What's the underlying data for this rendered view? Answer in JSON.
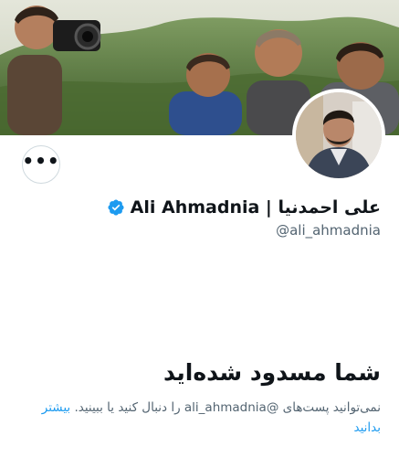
{
  "profile": {
    "display_name": "Ali Ahmadnia | علی احمدنیا",
    "handle": "@ali_ahmadnia",
    "verified": true,
    "more_icon": "more-horizontal-icon",
    "more_label": "•••"
  },
  "blocked": {
    "title": "شما مسدود شده‌اید",
    "message": "نمی‌توانید پست‌های @ali_ahmadnia را دنبال کنید یا ببینید.",
    "learn_more": "بیشتر بدانید"
  },
  "colors": {
    "accent": "#1d9bf0",
    "text_primary": "#0f1419",
    "text_secondary": "#536471",
    "border": "#cfd9de"
  }
}
